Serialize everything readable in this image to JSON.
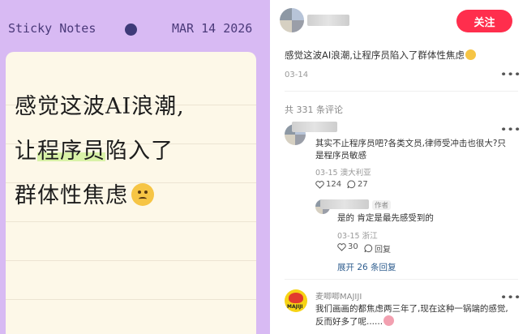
{
  "note": {
    "brand": "Sticky Notes",
    "date": "MAR 14 2026",
    "line1": "感觉这波AI浪潮,",
    "line2_pre": "让",
    "line2_hl": "程序员",
    "line2_post": "陷入了",
    "line3": "群体性焦虑"
  },
  "post": {
    "follow_label": "关注",
    "text": "感觉这波AI浪潮,让程序员陷入了群体性焦虑",
    "date": "03-14",
    "comment_count": "共 331 条评论"
  },
  "comments": [
    {
      "text_line1": "其实不止程序员吧?各类文员,律师受冲击也很大?只",
      "text_line2": "是程序员敏感",
      "meta": "03-15 澳大利亚",
      "likes": "124",
      "replies": "27"
    }
  ],
  "reply": {
    "author_tag": "作者",
    "text": "是的 肯定是最先感受到的",
    "meta": "03-15 浙江",
    "likes": "30",
    "reply_label": "回复"
  },
  "expand_label": "展开 26 条回复",
  "comment2": {
    "username": "麦唧唧MAJIJI",
    "avatar_label": "MAJIJI",
    "text_line1": "我们画画的都焦虑两三年了,现在这种一锅端的感觉,",
    "text_line2": "反而好多了呢......"
  },
  "colors": {
    "note_bg": "#d8baf3",
    "follow_button": "#ff2e4d",
    "link": "#2f5e8f"
  }
}
